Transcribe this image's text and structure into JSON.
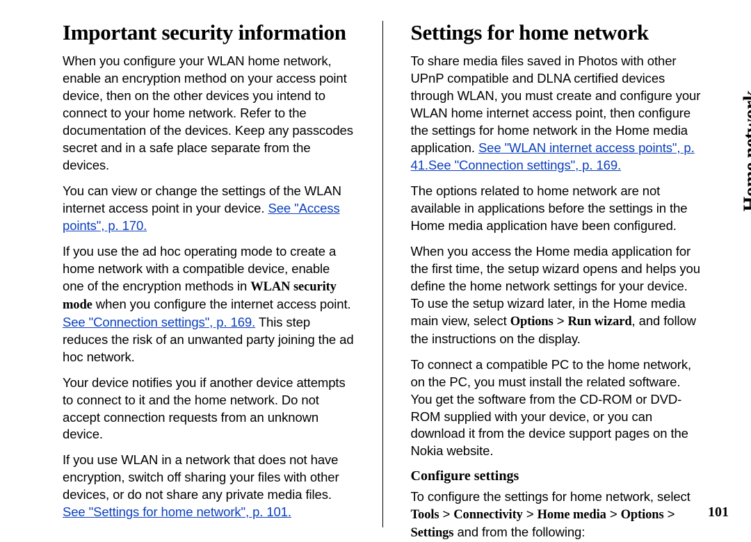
{
  "sideTitle": "Home network",
  "pageNumber": "101",
  "left": {
    "heading": "Important security information",
    "p1": "When you configure your WLAN home network, enable an encryption method on your access point device, then on the other devices you intend to connect to your home network. Refer to the documentation of the devices. Keep any passcodes secret and in a safe place separate from the devices.",
    "p2_a": "You can view or change the settings of the WLAN internet access point in your device. ",
    "p2_link": "See \"Access points\", p. 170.",
    "p3_a": "If you use the ad hoc operating mode to create a home network with a compatible device, enable one of the encryption methods in ",
    "p3_bold": "WLAN security mode",
    "p3_b": " when you configure the internet access point. ",
    "p3_link": "See \"Connection settings\", p. 169.",
    "p3_c": " This step reduces the risk of an unwanted party joining the ad hoc network.",
    "p4": "Your device notifies you if another device attempts to connect to it and the home network. Do not accept connection requests from an unknown device.",
    "p5_a": "If you use WLAN in a network that does not have encryption, switch off sharing your files with other devices, or do not share any private media files. ",
    "p5_link": "See \"Settings for home network\", p. 101."
  },
  "right": {
    "heading": "Settings for home network",
    "p1_a": "To share media files saved in Photos with other UPnP compatible and DLNA certified devices through WLAN, you must create and configure your WLAN home internet access point, then configure the settings for home network in the Home media application. ",
    "p1_link1": "See \"WLAN internet access points\", p. 41.",
    "p1_link2": "See \"Connection settings\", p. 169.",
    "p2": "The options related to home network are not available in applications before the settings in the Home media application have been configured.",
    "p3_a": "When you access the Home media application for the first time, the setup wizard opens and helps you define the home network settings for your device. To use the setup wizard later, in the Home media main view, select ",
    "p3_bold1": "Options",
    "p3_sep": " > ",
    "p3_bold2": "Run wizard",
    "p3_b": ", and follow the instructions on the display.",
    "p4": "To connect a compatible PC to the home network, on the PC, you must install the related software. You get the software from the CD-ROM or DVD-ROM supplied with your device, or you can download it from the device support pages on the Nokia website.",
    "subheading": "Configure settings",
    "p5_a": "To configure the settings for home network, select ",
    "nav_tools": "Tools",
    "nav_conn": "Connectivity",
    "nav_home": "Home media",
    "nav_opt": "Options",
    "nav_set": "Settings",
    "p5_b": " and from the following:"
  }
}
